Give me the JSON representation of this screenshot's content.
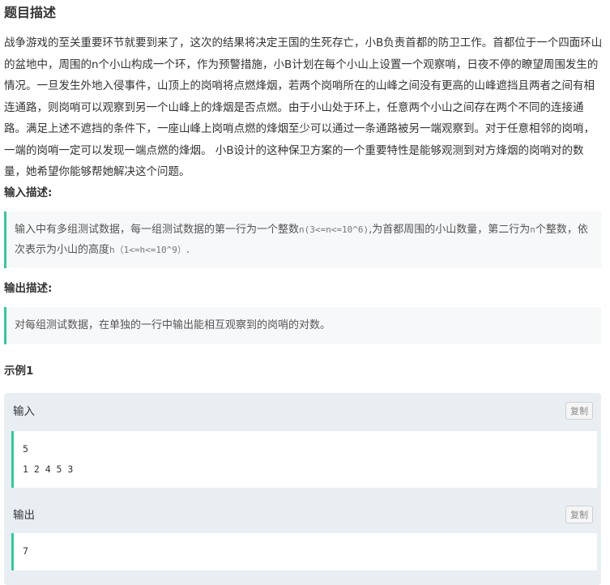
{
  "title": "题目描述",
  "description": "战争游戏的至关重要环节就要到来了，这次的结果将决定王国的生死存亡，小B负责首都的防卫工作。首都位于一个四面环山的盆地中，周围的n个小山构成一个环，作为预警措施，小B计划在每个小山上设置一个观察哨，日夜不停的瞭望周围发生的情况。一旦发生外地入侵事件，山顶上的岗哨将点燃烽烟，若两个岗哨所在的山峰之间没有更高的山峰遮挡且两者之间有相连通路，则岗哨可以观察到另一个山峰上的烽烟是否点燃。由于小山处于环上，任意两个小山之间存在两个不同的连接通路。满足上述不遮挡的条件下，一座山峰上岗哨点燃的烽烟至少可以通过一条通路被另一端观察到。对于任意相邻的岗哨，一端的岗哨一定可以发现一端点燃的烽烟。 小B设计的这种保卫方案的一个重要特性是能够观测到对方烽烟的岗哨对的数量，她希望你能够帮她解决这个问题。",
  "input_section": {
    "heading": "输入描述:",
    "text_part1": "输入中有多组测试数据，每一组测试数据的第一行为一个整数",
    "code1": "n(3<=n<=10^6)",
    "text_part2": ",为首都周围的小山数量，第二行为",
    "code2": "n",
    "text_part3": "个整数，依次表示为小山的高度",
    "code3": "h（1<=h<=10^9）",
    "text_part4": "."
  },
  "output_section": {
    "heading": "输出描述:",
    "text": "对每组测试数据，在单独的一行中输出能相互观察到的岗哨的对数。"
  },
  "example": {
    "heading": "示例1",
    "input_label": "输入",
    "input_lines": [
      "5",
      "1 2 4 5 3"
    ],
    "output_label": "输出",
    "output_lines": [
      "7"
    ],
    "copy_label": "复制"
  },
  "colors": {
    "accent": "#32ca99",
    "quote_bg": "#f7f8fa",
    "example_bg": "#e9eef3"
  }
}
